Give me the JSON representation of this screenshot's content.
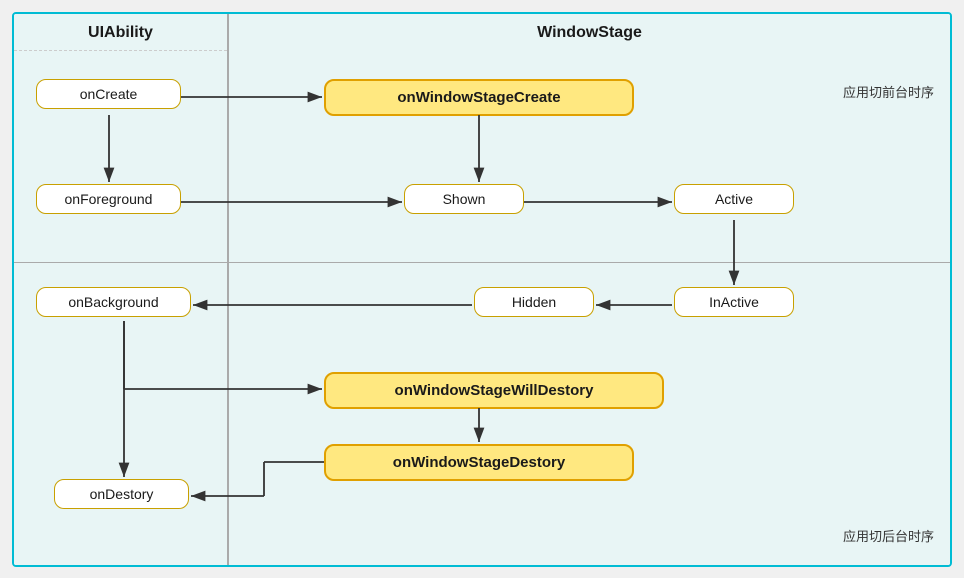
{
  "diagram": {
    "title_left": "UIAbility",
    "title_right": "WindowStage",
    "label_top_right": "应用切前台时序",
    "label_bottom_right": "应用切后台时序",
    "nodes": {
      "onCreate": "onCreate",
      "onForeground": "onForeground",
      "onBackground": "onBackground",
      "onDestory": "onDestory",
      "onWindowStageCreate": "onWindowStageCreate",
      "shown": "Shown",
      "active": "Active",
      "inactive": "InActive",
      "hidden": "Hidden",
      "onWindowStageWillDestory": "onWindowStageWillDestory",
      "onWindowStageDestory": "onWindowStageDestory"
    }
  }
}
